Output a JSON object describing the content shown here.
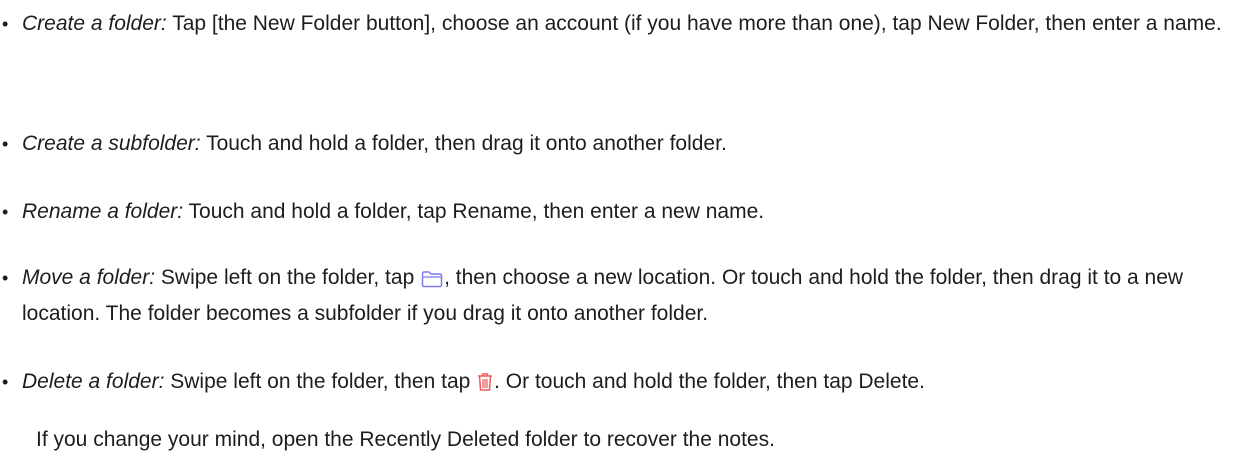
{
  "items": [
    {
      "term": "Create a folder:",
      "text": " Tap [the New Folder button], choose an account (if you have more than one), tap New Folder, then enter a name."
    },
    {
      "term": "Create a subfolder:",
      "text": " Touch and hold a folder, then drag it onto another folder."
    },
    {
      "term": "Rename a folder:",
      "text": " Touch and hold a folder, tap Rename, then enter a new name."
    },
    {
      "term": "Move a folder:",
      "text_before_icon": " Swipe left on the folder, tap ",
      "icon": "folder-icon",
      "text_after_icon": ", then choose a new location. Or touch and hold the folder, then drag it to a new location. The folder becomes a subfolder if you drag it onto another folder."
    },
    {
      "term": "Delete a folder:",
      "text_before_icon": " Swipe left on the folder, then tap ",
      "icon": "trash-icon",
      "text_after_icon": ". Or touch and hold the folder, then tap Delete."
    }
  ],
  "note": "If you change your mind, open the Recently Deleted folder to recover the notes.",
  "colors": {
    "text": "#1d1d1f",
    "folder_icon": "#7b7cf2",
    "trash_icon": "#f05a5a"
  }
}
